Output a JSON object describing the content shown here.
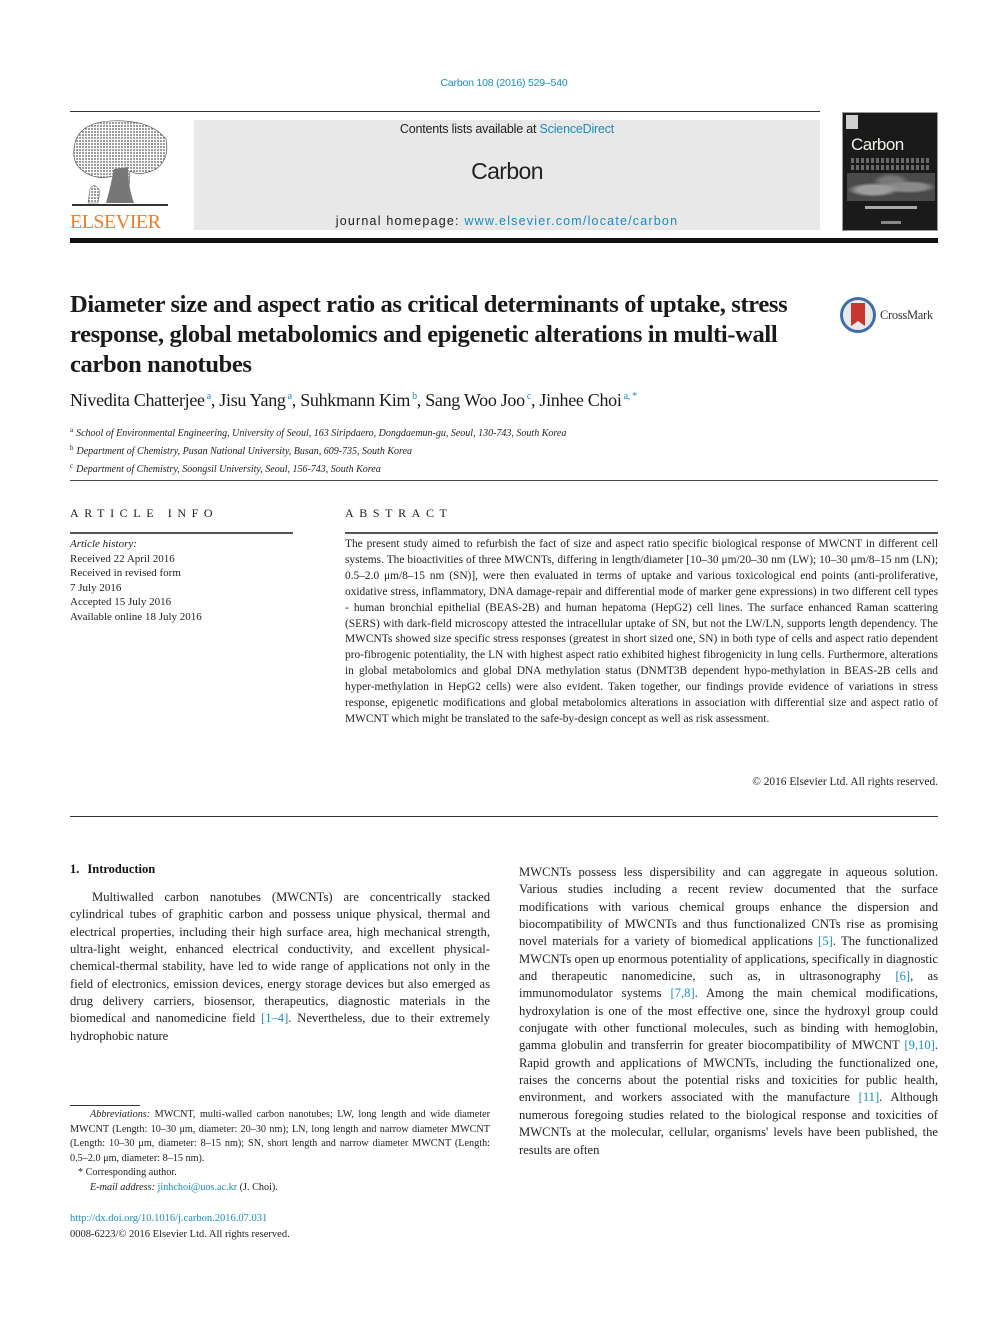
{
  "header": {
    "citation": "Carbon 108 (2016) 529–540",
    "contents_prefix": "Contents lists available at ",
    "contents_link": "ScienceDirect",
    "journal_name": "Carbon",
    "homepage_prefix": "journal homepage: ",
    "homepage_link": "www.elsevier.com/locate/carbon",
    "publisher_logo_text": "ELSEVIER",
    "cover_title": "Carbon",
    "publisher_color": "#f07c24",
    "link_color": "#1c8bc0"
  },
  "article": {
    "title": "Diameter size and aspect ratio as critical determinants of uptake, stress response, global metabolomics and epigenetic alterations in multi-wall carbon nanotubes",
    "crossmark_label": "CrossMark",
    "authors": [
      {
        "name": "Nivedita Chatterjee",
        "sup": "a",
        "sep": ", "
      },
      {
        "name": "Jisu Yang",
        "sup": "a",
        "sep": ", "
      },
      {
        "name": "Suhkmann Kim",
        "sup": "b",
        "sep": ", "
      },
      {
        "name": "Sang Woo Joo",
        "sup": "c",
        "sep": ", "
      },
      {
        "name": "Jinhee Choi",
        "sup": "a, *",
        "sep": ""
      }
    ],
    "affiliations": [
      {
        "key": "a",
        "text": "School of Environmental Engineering, University of Seoul, 163 Siripdaero, Dongdaemun-gu, Seoul, 130-743, South Korea"
      },
      {
        "key": "b",
        "text": "Department of Chemistry, Pusan National University, Busan, 609-735, South Korea"
      },
      {
        "key": "c",
        "text": "Department of Chemistry, Soongsil University, Seoul, 156-743, South Korea"
      }
    ]
  },
  "article_info": {
    "heading": "ARTICLE INFO",
    "history_label": "Article history:",
    "history": [
      "Received 22 April 2016",
      "Received in revised form",
      "7 July 2016",
      "Accepted 15 July 2016",
      "Available online 18 July 2016"
    ]
  },
  "abstract": {
    "heading": "ABSTRACT",
    "text": "The present study aimed to refurbish the fact of size and aspect ratio specific biological response of MWCNT in different cell systems. The bioactivities of three MWCNTs, differing in length/diameter [10–30 μm/20–30 nm (LW); 10–30 μm/8–15 nm (LN); 0.5–2.0 μm/8–15 nm (SN)], were then evaluated in terms of uptake and various toxicological end points (anti-proliferative, oxidative stress, inflammatory, DNA damage-repair and differential mode of marker gene expressions) in two different cell types - human bronchial epithelial (BEAS-2B) and human hepatoma (HepG2) cell lines. The surface enhanced Raman scattering (SERS) with dark-field microscopy attested the intracellular uptake of SN, but not the LW/LN, supports length dependency. The MWCNTs showed size specific stress responses (greatest in short sized one, SN) in both type of cells and aspect ratio dependent pro-fibrogenic potentiality, the LN with highest aspect ratio exhibited highest fibrogenicity in lung cells. Furthermore, alterations in global metabolomics and global DNA methylation status (DNMT3B dependent hypo-methylation in BEAS-2B cells and hyper-methylation in HepG2 cells) were also evident. Taken together, our findings provide evidence of variations in stress response, epigenetic modifications and global metabolomics alterations in association with differential size and aspect ratio of MWCNT which might be translated to the safe-by-design concept as well as risk assessment.",
    "copyright": "© 2016 Elsevier Ltd. All rights reserved."
  },
  "introduction": {
    "number": "1.",
    "heading": "Introduction",
    "left_text_before_ref": "Multiwalled carbon nanotubes (MWCNTs) are concentrically stacked cylindrical tubes of graphitic carbon and possess unique physical, thermal and electrical properties, including their high surface area, high mechanical strength, ultra-light weight, enhanced electrical conductivity, and excellent physical-chemical-thermal stability, have led to wide range of applications not only in the field of electronics, emission devices, energy storage devices but also emerged as drug delivery carriers, biosensor, therapeutics, diagnostic materials in the biomedical and nanomedicine field ",
    "left_ref": "[1–4]",
    "left_text_after_ref": ". Nevertheless, due to their extremely hydrophobic nature",
    "right_segments": [
      {
        "t": "MWCNTs possess less dispersibility and can aggregate in aqueous solution. Various studies including a recent review documented that the surface modifications with various chemical groups enhance the dispersion and biocompatibility of MWCNTs and thus functionalized CNTs rise as promising novel materials for a variety of biomedical applications "
      },
      {
        "ref": "[5]"
      },
      {
        "t": ". The functionalized MWCNTs open up enormous potentiality of applications, specifically in diagnostic and therapeutic nanomedicine, such as, in ultrasonography "
      },
      {
        "ref": "[6]"
      },
      {
        "t": ", as immunomodulator systems "
      },
      {
        "ref": "[7,8]"
      },
      {
        "t": ". Among the main chemical modifications, hydroxylation is one of the most effective one, since the hydroxyl group could conjugate with other functional molecules, such as binding with hemoglobin, gamma globulin and transferrin for greater biocompatibility of MWCNT "
      },
      {
        "ref": "[9,10]"
      },
      {
        "t": ". Rapid growth and applications of MWCNTs, including the functionalized one, raises the concerns about the potential risks and toxicities for public health, environment, and workers associated with the manufacture "
      },
      {
        "ref": "[11]"
      },
      {
        "t": ". Although numerous foregoing studies related to the biological response and toxicities of MWCNTs at the molecular, cellular, organisms' levels have been published, the results are often"
      }
    ]
  },
  "footnotes": {
    "abbrev_label": "Abbreviations:",
    "abbrev_text": " MWCNT, multi-walled carbon nanotubes; LW, long length and wide diameter MWCNT (Length: 10–30 μm, diameter: 20–30 nm); LN, long length and narrow diameter MWCNT (Length: 10–30 μm, diameter: 8–15 nm); SN, short length and narrow diameter MWCNT (Length: 0.5–2.0 μm, diameter: 8–15 nm).",
    "corresponding": "* Corresponding author.",
    "email_label": "E-mail address:",
    "email": "jinhchoi@uos.ac.kr",
    "email_suffix": " (J. Choi).",
    "doi": "http://dx.doi.org/10.1016/j.carbon.2016.07.031",
    "issn": "0008-6223/© 2016 Elsevier Ltd. All rights reserved."
  }
}
